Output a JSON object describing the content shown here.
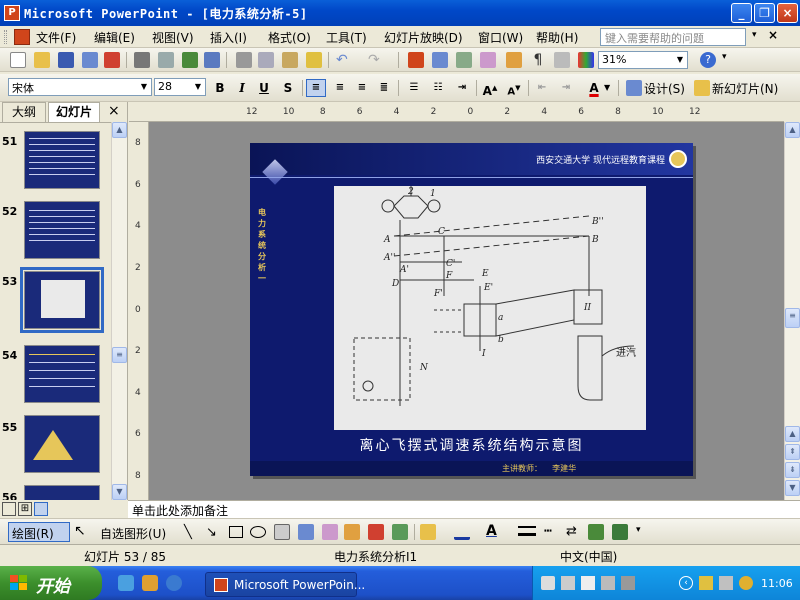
{
  "window": {
    "title": "Microsoft PowerPoint - [电力系统分析-5]",
    "app_icon_letter": "P"
  },
  "menu": [
    "文件(F)",
    "编辑(E)",
    "视图(V)",
    "插入(I)",
    "格式(O)",
    "工具(T)",
    "幻灯片放映(D)",
    "窗口(W)",
    "帮助(H)"
  ],
  "help_search": {
    "placeholder": "键入需要帮助的问题"
  },
  "standard_toolbar": {
    "zoom": "31%"
  },
  "format_toolbar": {
    "font": "宋体",
    "font_size": "28",
    "bold": "B",
    "italic": "I",
    "underline": "U",
    "shadow": "S",
    "design_label": "设计(S)",
    "new_slide_label": "新幻灯片(N)"
  },
  "left_panel": {
    "tabs": [
      "大纲",
      "幻灯片"
    ],
    "close": "×",
    "slides": [
      {
        "num": "51",
        "selected": false
      },
      {
        "num": "52",
        "selected": false
      },
      {
        "num": "53",
        "selected": true
      },
      {
        "num": "54",
        "selected": false
      },
      {
        "num": "55",
        "selected": false
      },
      {
        "num": "56",
        "selected": false
      }
    ]
  },
  "ruler": {
    "h_labels": [
      "12",
      "10",
      "8",
      "6",
      "4",
      "2",
      "0",
      "2",
      "4",
      "6",
      "8",
      "10",
      "12"
    ],
    "v_labels": [
      "8",
      "6",
      "4",
      "2",
      "0",
      "2",
      "4",
      "6",
      "8"
    ]
  },
  "slide": {
    "header_text": "西安交通大学  现代远程教育课程",
    "side_text": "电力系统分析一",
    "caption": "离心飞摆式调速系统结构示意图",
    "footer_label": "主讲教师：",
    "footer_name": "李建华",
    "figure_labels": {
      "A": "A",
      "A2": "A''",
      "A1": "A'",
      "B": "B",
      "B2": "B''",
      "C": "C",
      "C1": "C'",
      "D": "D",
      "E": "E",
      "E1": "E'",
      "F": "F",
      "F1": "F'",
      "a": "a",
      "b": "b",
      "I": "I",
      "II": "II",
      "N": "N",
      "inlet": "进汽",
      "num1": "1",
      "num2": "2"
    }
  },
  "notes": {
    "placeholder": "单击此处添加备注"
  },
  "drawing_toolbar": {
    "draw_label": "绘图(R)",
    "autoshape_label": "自选图形(U)"
  },
  "status_bar": {
    "slide_position": "幻灯片 53 / 85",
    "design_name": "电力系统分析I1",
    "language": "中文(中国)"
  },
  "taskbar": {
    "start_label": "开始",
    "task_label": "Microsoft PowerPoin...",
    "clock": "11:06"
  }
}
